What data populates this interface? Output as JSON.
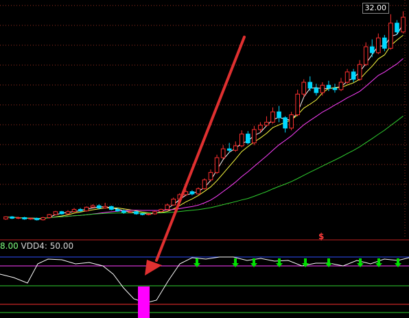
{
  "price_tag": "32.00",
  "indicator": {
    "value_partial": "8.00",
    "label": "VDD4: 50.00"
  },
  "signal_symbol": "$",
  "colors": {
    "background": "#000000",
    "grid": "#a03020",
    "up_candle": "#ff3030",
    "down_candle": "#00d8ff",
    "ma_short": "#ffffff",
    "ma_mid": "#ffff40",
    "ma_long": "#ff40ff",
    "ma_longest": "#30d030",
    "arrow": "#e03030",
    "signal_bar": "#ff00ff",
    "down_marker": "#00e000",
    "oscillator": "#ffffff"
  },
  "chart_data": {
    "type": "candlestick",
    "note_axis": "price axis top label 32.00",
    "candles": [
      [
        4.3,
        4.6,
        4.6,
        4.2
      ],
      [
        4.6,
        4.4,
        4.7,
        4.3
      ],
      [
        4.4,
        4.5,
        4.6,
        4.3
      ],
      [
        4.5,
        4.3,
        4.6,
        4.2
      ],
      [
        4.3,
        4.4,
        4.5,
        4.2
      ],
      [
        4.4,
        4.2,
        4.5,
        4.1
      ],
      [
        4.2,
        4.5,
        4.6,
        4.1
      ],
      [
        4.5,
        4.9,
        5.0,
        4.4
      ],
      [
        4.9,
        5.3,
        5.4,
        4.8
      ],
      [
        5.3,
        5.0,
        5.4,
        4.9
      ],
      [
        5.0,
        5.3,
        5.5,
        4.9
      ],
      [
        5.3,
        5.6,
        5.8,
        5.2
      ],
      [
        5.6,
        5.4,
        5.8,
        5.3
      ],
      [
        5.4,
        5.9,
        6.0,
        5.3
      ],
      [
        5.9,
        6.1,
        6.3,
        5.8
      ],
      [
        6.1,
        5.8,
        6.3,
        5.6
      ],
      [
        5.8,
        6.0,
        6.5,
        5.7
      ],
      [
        6.0,
        5.6,
        6.1,
        5.5
      ],
      [
        5.6,
        5.4,
        5.8,
        5.3
      ],
      [
        5.4,
        5.2,
        5.6,
        5.0
      ],
      [
        5.2,
        5.3,
        5.4,
        5.1
      ],
      [
        5.3,
        5.0,
        5.4,
        4.9
      ],
      [
        5.0,
        4.9,
        5.1,
        4.8
      ],
      [
        4.9,
        5.0,
        5.1,
        4.8
      ],
      [
        5.0,
        5.3,
        5.4,
        4.9
      ],
      [
        5.3,
        5.6,
        5.7,
        5.2
      ],
      [
        5.6,
        6.2,
        6.4,
        5.5
      ],
      [
        6.2,
        7.0,
        7.2,
        6.1
      ],
      [
        7.0,
        7.6,
        7.8,
        6.9
      ],
      [
        7.6,
        8.0,
        8.3,
        7.4
      ],
      [
        8.0,
        7.7,
        8.2,
        7.5
      ],
      [
        7.7,
        8.4,
        8.6,
        7.6
      ],
      [
        8.4,
        9.6,
        9.8,
        8.3
      ],
      [
        9.6,
        10.6,
        11.0,
        9.4
      ],
      [
        10.6,
        12.6,
        13.0,
        10.4
      ],
      [
        12.6,
        13.8,
        14.3,
        12.4
      ],
      [
        13.8,
        13.6,
        14.6,
        13.3
      ],
      [
        13.6,
        14.2,
        14.8,
        13.4
      ],
      [
        14.2,
        15.8,
        16.3,
        14.0
      ],
      [
        15.8,
        14.6,
        16.2,
        14.4
      ],
      [
        14.6,
        16.4,
        16.9,
        14.3
      ],
      [
        16.4,
        17.0,
        17.4,
        16.0
      ],
      [
        17.0,
        17.4,
        18.2,
        16.8
      ],
      [
        17.4,
        18.8,
        19.4,
        17.2
      ],
      [
        18.8,
        18.0,
        19.6,
        17.4
      ],
      [
        18.0,
        16.6,
        18.2,
        16.0
      ],
      [
        16.6,
        18.4,
        18.8,
        16.3
      ],
      [
        18.4,
        21.2,
        21.8,
        18.2
      ],
      [
        21.2,
        22.8,
        23.2,
        20.8
      ],
      [
        22.8,
        22.0,
        23.6,
        21.6
      ],
      [
        22.0,
        21.4,
        22.6,
        21.0
      ],
      [
        21.4,
        22.4,
        22.8,
        21.0
      ],
      [
        22.4,
        22.0,
        23.0,
        21.6
      ],
      [
        22.0,
        21.8,
        22.6,
        21.4
      ],
      [
        21.8,
        22.8,
        23.4,
        21.6
      ],
      [
        22.8,
        24.2,
        24.6,
        22.6
      ],
      [
        24.2,
        23.2,
        24.6,
        22.8
      ],
      [
        23.2,
        25.2,
        25.8,
        23.0
      ],
      [
        25.2,
        27.6,
        28.2,
        25.0
      ],
      [
        27.6,
        26.8,
        28.6,
        26.2
      ],
      [
        26.8,
        28.8,
        29.4,
        26.6
      ],
      [
        28.8,
        27.4,
        29.2,
        27.0
      ],
      [
        27.4,
        30.8,
        32.0,
        27.2
      ],
      [
        30.8,
        29.6,
        31.2,
        29.2
      ],
      [
        29.6,
        31.6,
        32.4,
        29.4
      ]
    ]
  }
}
